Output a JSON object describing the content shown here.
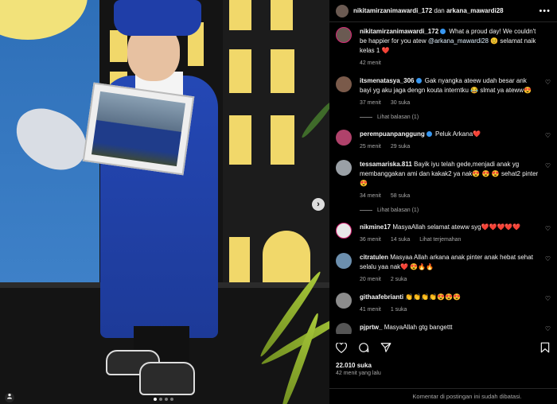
{
  "header": {
    "owner": "nikitamirzanimawardi_172",
    "joiner": "dan",
    "collaborator": "arkana_mawardi28",
    "more_label": "•••"
  },
  "caption": {
    "user": "nikitamirzanimawardi_172",
    "text_before": "What a proud day! We couldn't be happier for you atew",
    "mention": "@arkana_mawardi28",
    "text_after": "😊 selamat naik kelas 1 ❤️",
    "time": "42 menit"
  },
  "comments": [
    {
      "user": "itsmenatasya_306",
      "text": "Gak nyangka ateew udah besar ank bayi yg aku jaga dengn kouta interntku 😂 slmat ya ateww😍",
      "time": "37 menit",
      "likes": "30 suka",
      "verified": true,
      "replies": "Lihat balasan (1)",
      "avatar": "#7a5a4a"
    },
    {
      "user": "perempuanpanggung",
      "text": "Peluk Arkana❤️",
      "time": "25 menit",
      "likes": "29 suka",
      "verified": true,
      "avatar": "#b0426b"
    },
    {
      "user": "tessamariska.811",
      "text": "Bayik iyu telah gede,menjadi anak yg membanggakan ami dan kakak2 ya nak😍 😍 😍 sehat2 pinter😍",
      "time": "34 menit",
      "likes": "58 suka",
      "replies": "Lihat balasan (1)",
      "avatar": "#9aa0a6"
    },
    {
      "user": "nikmine17",
      "text": "MasyaAllah selamat ateww syg❤️❤️❤️❤️❤️",
      "time": "36 menit",
      "likes": "14 suka",
      "extra": "Lihat terjemahan",
      "avatar": "#e8e8e8"
    },
    {
      "user": "citratulen",
      "text": "Masyaa Allah arkana anak pinter anak hebat sehat selalu yaa nak❤️ 😍🔥🔥",
      "time": "20 menit",
      "likes": "2 suka",
      "avatar": "#6c8fae"
    },
    {
      "user": "githaafebrianti",
      "text": "👏👏👏👏😍😍😍",
      "time": "41 menit",
      "likes": "1 suka",
      "avatar": "#8c8c8c"
    },
    {
      "user": "pjprtw_",
      "text": "MasyaAllah gtg bangettt",
      "time": "",
      "likes": "",
      "avatar": "#555555"
    }
  ],
  "actions": {
    "likes": "22.010 suka",
    "time": "42 menit yang lalu",
    "comments_disabled": "Komentar di postingan ini sudah dibatasi."
  },
  "photo": {
    "next_glyph": "›",
    "slide_count": 4,
    "active_slide": 1
  },
  "colors": {
    "heart": "#ff3040",
    "verified": "#3897f0",
    "muted": "#a8a8a8"
  }
}
